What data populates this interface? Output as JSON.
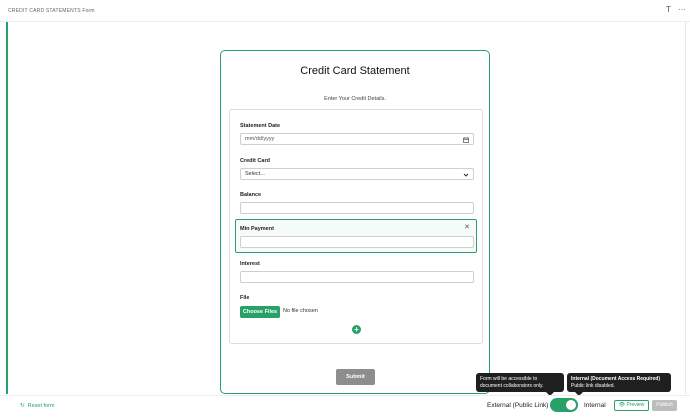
{
  "header": {
    "title": "CREDIT CARD STATEMENTS Form",
    "font_icon": "T",
    "more_icon": "···"
  },
  "form": {
    "title": "Credit Card Statement",
    "subtitle": "Enter Your Credit Details.",
    "fields": {
      "statement_date": {
        "label": "Statement Date",
        "placeholder": "mm/dd/yyyy"
      },
      "credit_card": {
        "label": "Credit Card",
        "value": "Select..."
      },
      "balance": {
        "label": "Balance",
        "value": ""
      },
      "min_payment": {
        "label": "Min Payment",
        "value": ""
      },
      "interest": {
        "label": "Interest",
        "value": ""
      },
      "file": {
        "label": "File",
        "button": "Choose Files",
        "status": "No file chosen"
      }
    },
    "add_icon": "+",
    "submit_label": "Submit"
  },
  "footer": {
    "reset_label": "Reset form",
    "external_label": "External (Public Link)",
    "internal_label": "Internal",
    "preview_label": "Preview",
    "publish_label": "Publish",
    "toggle_state": "internal"
  },
  "tooltips": {
    "external": "Form will be accessible to document collaborators only.",
    "internal_title": "Internal (Document Access Required)",
    "internal_body": "Public link disabled."
  },
  "colors": {
    "accent": "#27a168",
    "submit": "#8d8d8d",
    "publish_disabled": "#bdbdbd",
    "tooltip_bg": "#1f1f1f"
  }
}
